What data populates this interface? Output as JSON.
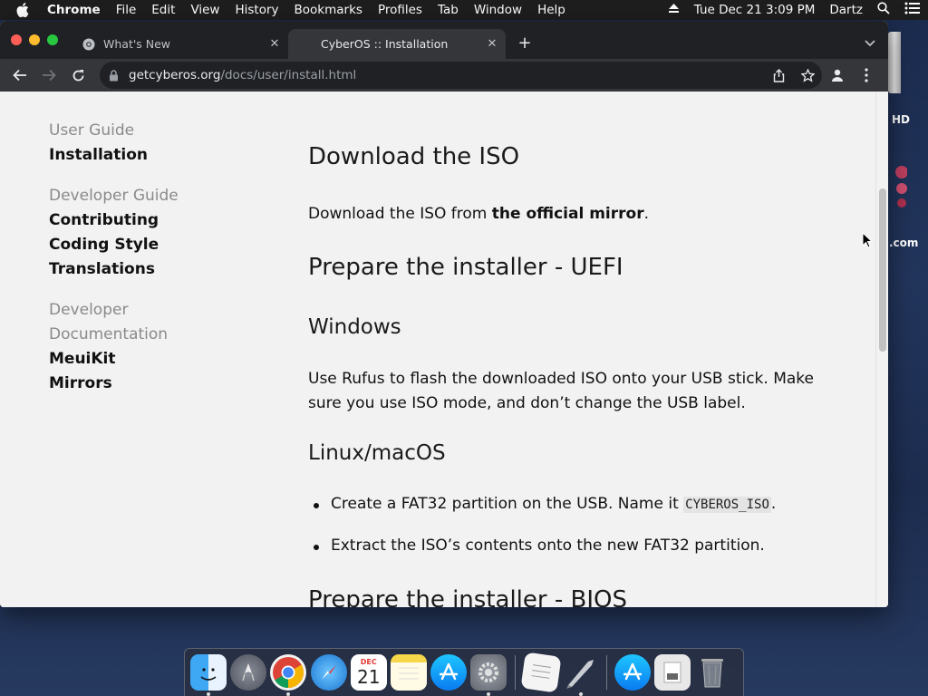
{
  "menubar": {
    "app": "Chrome",
    "items": [
      "File",
      "Edit",
      "View",
      "History",
      "Bookmarks",
      "Profiles",
      "Tab",
      "Window",
      "Help"
    ],
    "datetime": "Tue Dec 21  3:09 PM",
    "user": "Dartz"
  },
  "desktop": {
    "drive_label": "HD",
    "domain_label": ".com"
  },
  "tabs": [
    {
      "title": "What's New",
      "active": false
    },
    {
      "title": "CyberOS :: Installation",
      "active": true
    }
  ],
  "address": {
    "host": "getcyberos.org",
    "path": "/docs/user/install.html"
  },
  "sidebar": {
    "groups": [
      {
        "heading": "User Guide",
        "links": [
          "Installation"
        ]
      },
      {
        "heading": "Developer Guide",
        "links": [
          "Contributing",
          "Coding Style",
          "Translations"
        ]
      },
      {
        "heading": "Developer Documentation",
        "links": [
          "MeuiKit",
          "Mirrors"
        ]
      }
    ]
  },
  "content": {
    "h_download": "Download the ISO",
    "p_download_pre": "Download the ISO from ",
    "p_download_link": "the official mirror",
    "p_download_post": ".",
    "h_uefi": "Prepare the installer - UEFI",
    "h_windows": "Windows",
    "p_windows": "Use Rufus to flash the downloaded ISO onto your USB stick. Make sure you use ISO mode, and don’t change the USB label.",
    "h_linux": "Linux/macOS",
    "li1_pre": "Create a FAT32 partition on the USB. Name it ",
    "li1_code": "CYBEROS_ISO",
    "li1_post": ".",
    "li2": "Extract the ISO’s contents onto the new FAT32 partition.",
    "h_bios": "Prepare the installer - BIOS"
  },
  "dock": {
    "apps": [
      "finder",
      "launchpad",
      "chrome",
      "safari",
      "calendar",
      "notes",
      "app-store",
      "system-preferences",
      "textedit",
      "rocket",
      "app-store-downloads",
      "documents",
      "trash"
    ],
    "calendar_month": "DEC",
    "calendar_day": "21"
  },
  "colors": {
    "tabstrip": "#202124",
    "toolbar": "#35363a",
    "page_bg": "#f2f2f2",
    "link_text": "#111111"
  }
}
